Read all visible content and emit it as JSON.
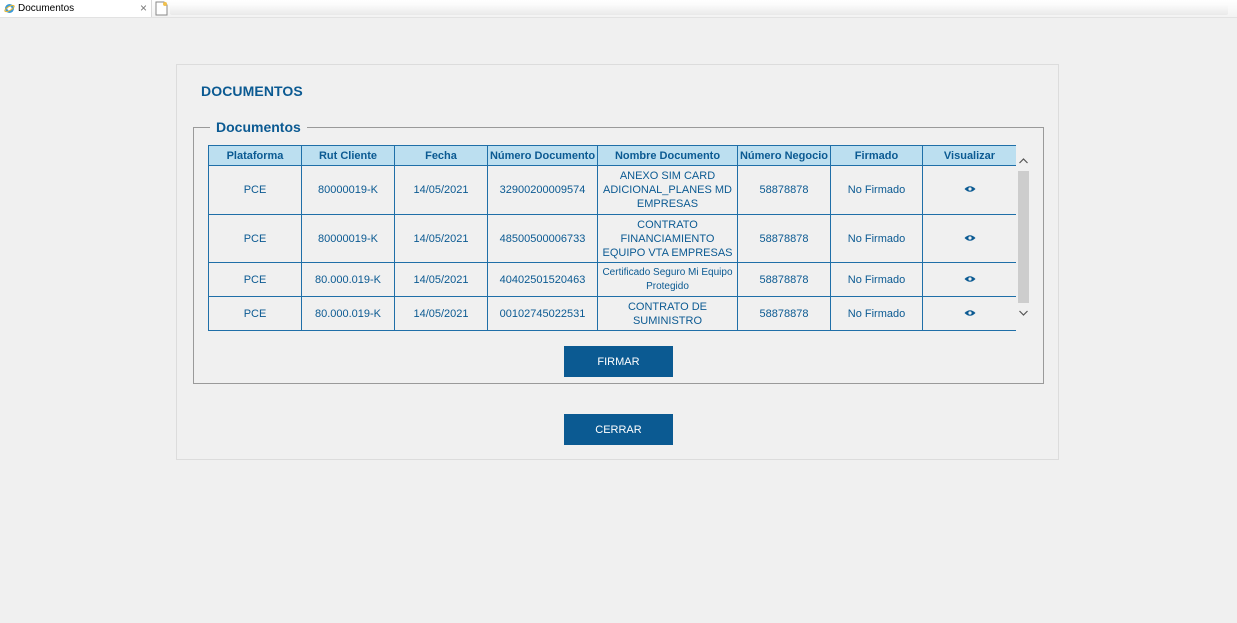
{
  "window": {
    "tab_title": "Documentos",
    "close_symbol": "×"
  },
  "page": {
    "title": "DOCUMENTOS",
    "fieldset_legend": "Documentos"
  },
  "table": {
    "headers": [
      "Plataforma",
      "Rut Cliente",
      "Fecha",
      "Número Documento",
      "Nombre Documento",
      "Número Negocio",
      "Firmado",
      "Visualizar"
    ],
    "rows": [
      {
        "plataforma": "PCE",
        "rut": "80000019-K",
        "fecha": "14/05/2021",
        "numero_documento": "32900200009574",
        "nombre_documento": "ANEXO SIM CARD ADICIONAL_PLANES MD EMPRESAS",
        "numero_negocio": "58878878",
        "firmado": "No Firmado",
        "visualizar_icon": "eye-icon"
      },
      {
        "plataforma": "PCE",
        "rut": "80000019-K",
        "fecha": "14/05/2021",
        "numero_documento": "48500500006733",
        "nombre_documento": "CONTRATO FINANCIAMIENTO EQUIPO VTA EMPRESAS",
        "numero_negocio": "58878878",
        "firmado": "No Firmado",
        "visualizar_icon": "eye-icon"
      },
      {
        "plataforma": "PCE",
        "rut": "80.000.019-K",
        "fecha": "14/05/2021",
        "numero_documento": "40402501520463",
        "nombre_documento": "Certificado Seguro Mi Equipo Protegido",
        "numero_negocio": "58878878",
        "firmado": "No Firmado",
        "visualizar_icon": "eye-icon"
      },
      {
        "plataforma": "PCE",
        "rut": "80.000.019-K",
        "fecha": "14/05/2021",
        "numero_documento": "00102745022531",
        "nombre_documento": "CONTRATO DE SUMINISTRO",
        "numero_negocio": "58878878",
        "firmado": "No Firmado",
        "visualizar_icon": "eye-icon"
      }
    ]
  },
  "buttons": {
    "firmar": "FIRMAR",
    "cerrar": "CERRAR"
  },
  "colors": {
    "accent": "#0b5a92",
    "header_bg": "#bcdff0",
    "border": "#1f6fa8",
    "background": "#f0f0f0"
  }
}
